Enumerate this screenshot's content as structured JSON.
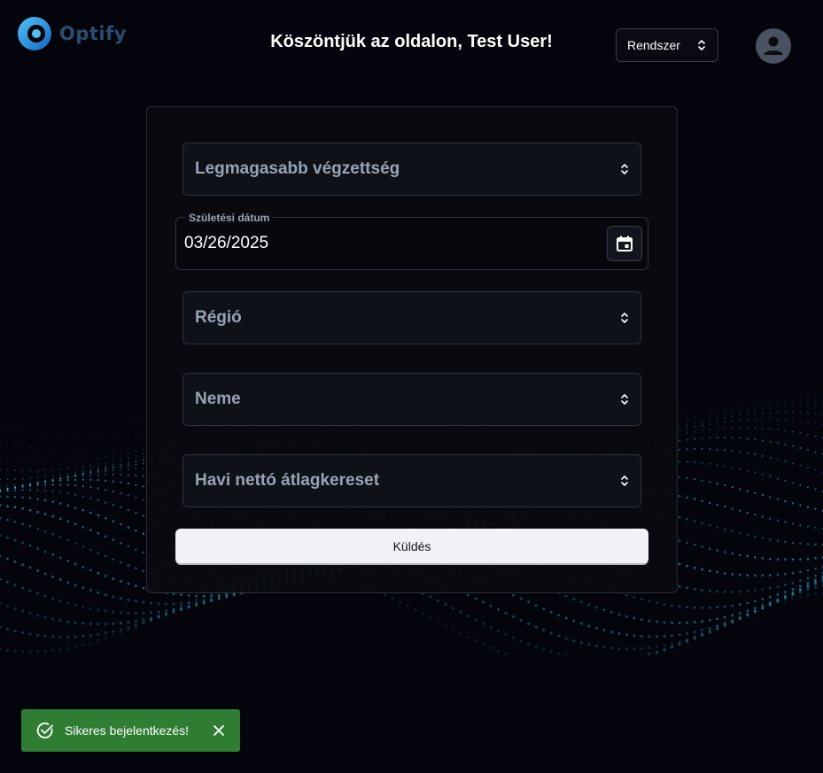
{
  "app": {
    "logo_text": "Optify",
    "welcome": "Köszöntjük az oldalon, Test User!",
    "theme_select": {
      "value": "Rendszer"
    }
  },
  "form": {
    "education": {
      "placeholder": "Legmagasabb végzettség"
    },
    "birth_date": {
      "label": "Születési dátum",
      "value": "03/26/2025"
    },
    "region": {
      "placeholder": "Régió"
    },
    "gender": {
      "placeholder": "Neme"
    },
    "income": {
      "placeholder": "Havi nettó átlagkereset"
    },
    "submit_label": "Küldés"
  },
  "toast": {
    "message": "Sikeres bejelentkezés!",
    "color": "#2e7d32"
  },
  "icons": {
    "select": "chevron-updown-icon",
    "date": "calendar-icon",
    "avatar": "user-icon",
    "toast": "check-circle-icon",
    "close": "close-icon"
  }
}
